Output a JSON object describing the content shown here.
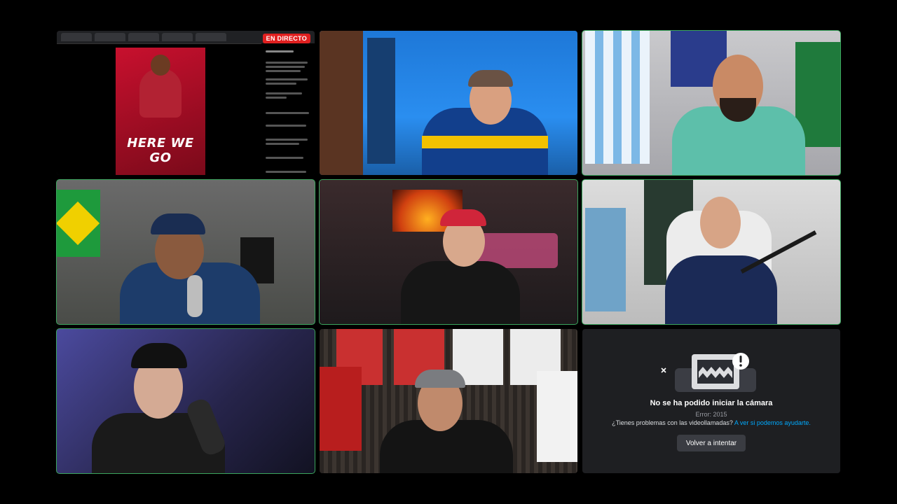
{
  "call": {
    "shared_screen": {
      "live_badge": "EN DIRECTO",
      "promo_headline": "HERE WE GO"
    },
    "camera_error": {
      "title": "No se ha podido iniciar la cámara",
      "code": "Error: 2015",
      "help_text": "¿Tienes problemas con las videollamadas?",
      "help_link": "A ver si podemos ayudarte.",
      "retry_button": "Volver a intentar"
    },
    "icons": [
      "warning-icon",
      "camera-icon",
      "close-icon"
    ],
    "colors": {
      "speaking_outline": "#3ba55d",
      "live_badge": "#e02020",
      "link": "#00a8fc",
      "button": "#3a3c42"
    }
  }
}
